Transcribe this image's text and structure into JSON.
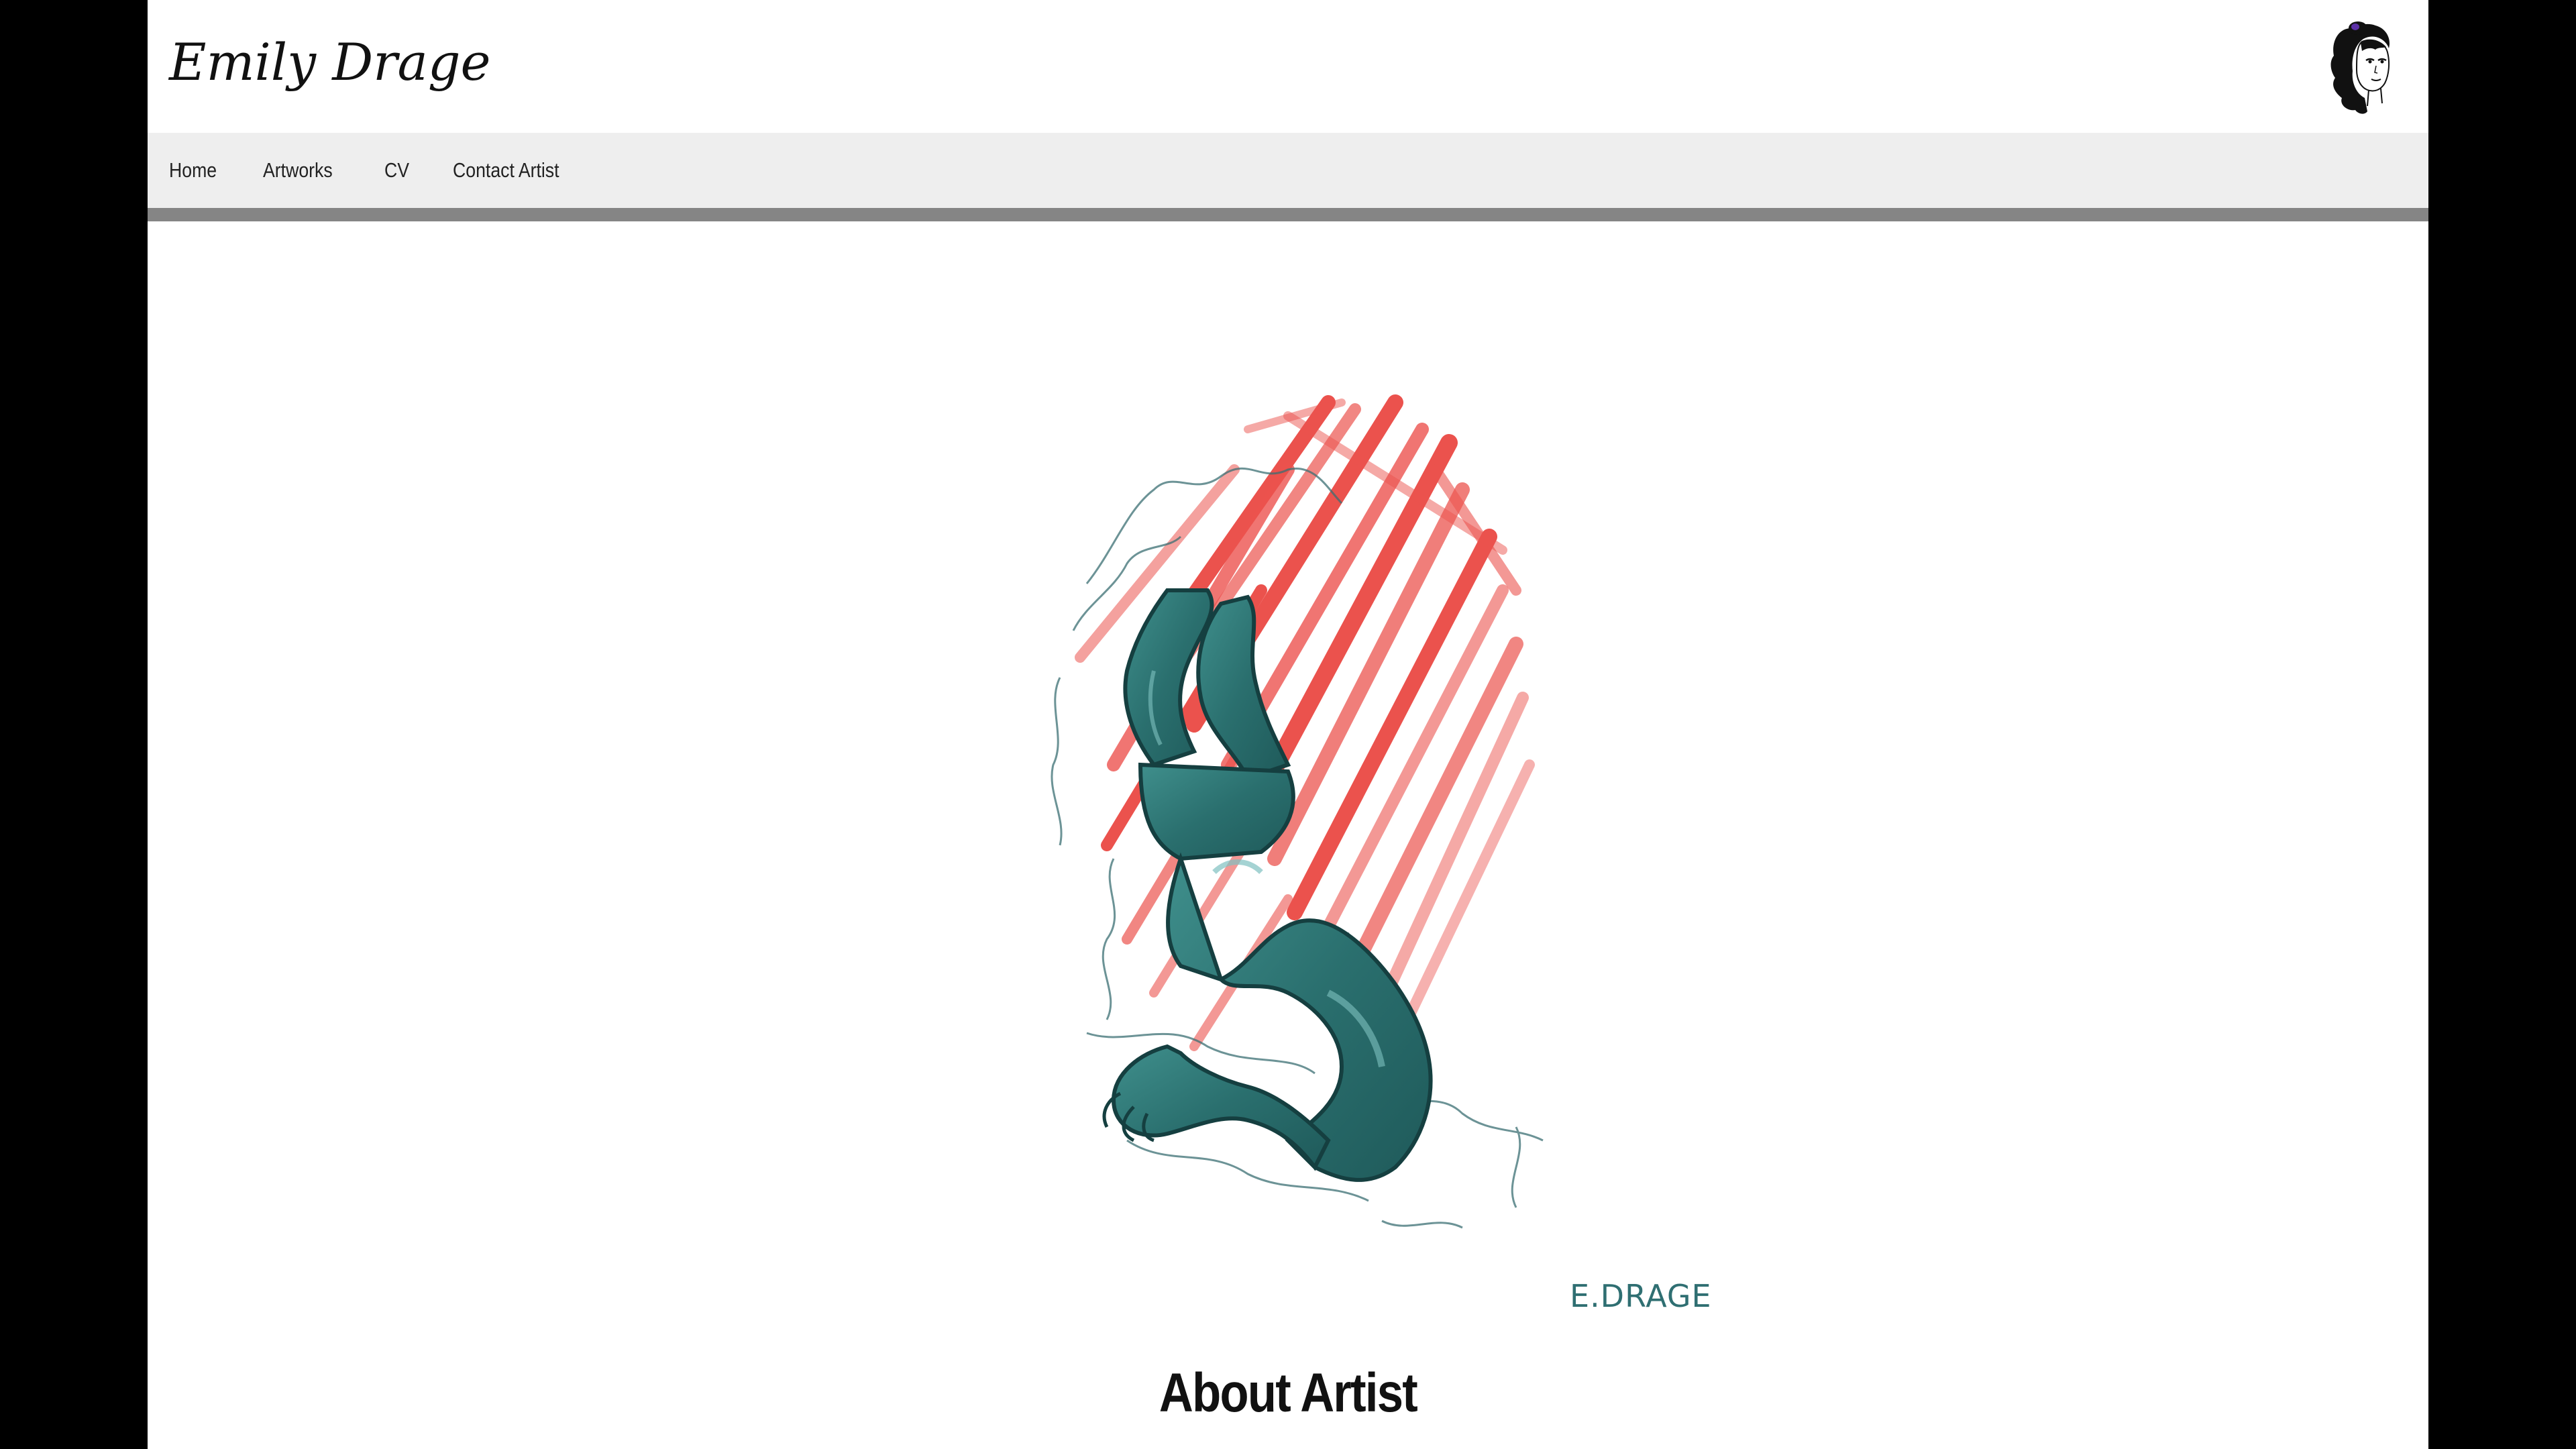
{
  "site": {
    "title": "Emily Drage"
  },
  "nav": {
    "items": [
      {
        "label": "Home"
      },
      {
        "label": "Artworks"
      },
      {
        "label": "CV"
      },
      {
        "label": "Contact Artist"
      }
    ]
  },
  "artwork": {
    "signature": "E.DRAGE"
  },
  "about": {
    "heading": "About Artist"
  },
  "colors": {
    "background": "#000000",
    "page": "#ffffff",
    "navbar": "#eeeeee",
    "navbar_border": "#858585",
    "artwork_red": "#e8352f",
    "artwork_teal": "#2f7a78"
  },
  "icons": {
    "avatar": "artist-portrait-icon"
  }
}
